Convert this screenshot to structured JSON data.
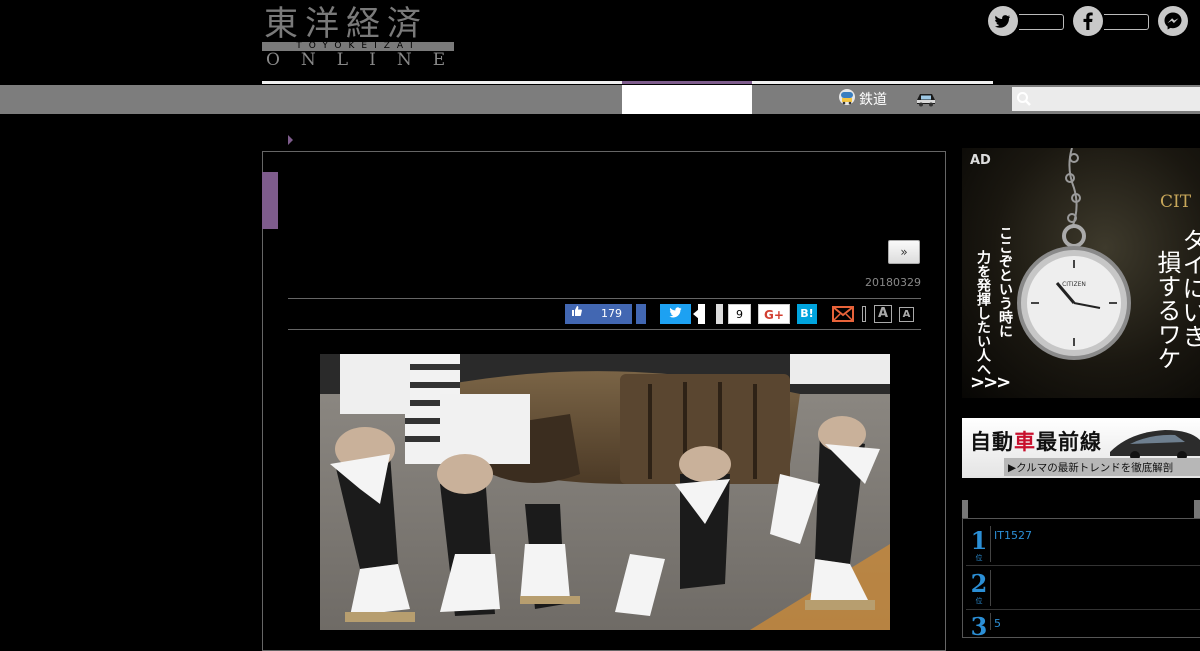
{
  "header": {
    "logo_kanji": "東洋経済",
    "logo_romaji": "TOYOKEIZAI",
    "logo_online": "ONLINE",
    "social": [
      "twitter-icon",
      "facebook-icon",
      "messenger-icon"
    ]
  },
  "nav": {
    "railway_label": "鉄道",
    "railway_icon": "train-icon",
    "car_icon": "car-icon",
    "search_placeholder": ""
  },
  "article": {
    "next_label": "»",
    "date": "20180329"
  },
  "share": {
    "facebook_count": "179",
    "pocket_count": "9",
    "gplus_label": "G+",
    "hatena_label": "B!",
    "font_large_label": "A",
    "font_small_label": "A"
  },
  "ad": {
    "label": "AD",
    "vertical_line_1": "力を発揮したい人へ",
    "vertical_line_2": "ここぞという時に",
    "arrows": ">>>",
    "brand": "CIT",
    "copy_line_1": "損するワケ",
    "copy_line_2": "タイにいき"
  },
  "car_banner": {
    "title_pre": "自動",
    "title_red": "車",
    "title_post": "最前線",
    "subtitle": "▶クルマの最新トレンドを徹底解剖"
  },
  "ranking": {
    "items": [
      {
        "rank": "1",
        "suffix": "位",
        "text": "IT1527"
      },
      {
        "rank": "2",
        "suffix": "位",
        "text": ""
      },
      {
        "rank": "3",
        "suffix": "位",
        "text": "5"
      }
    ]
  },
  "colors": {
    "accent": "#7e5c8c",
    "facebook": "#4267b2",
    "twitter": "#1da1f2",
    "hatena": "#00a4de",
    "rank": "#2b8fd6"
  }
}
